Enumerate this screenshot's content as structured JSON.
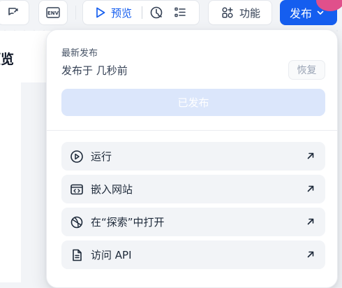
{
  "toolbar": {
    "preview_label": "预览",
    "features_label": "功能",
    "publish_label": "发布",
    "env_icon_text": "ENV"
  },
  "page": {
    "title": "预览"
  },
  "publish_panel": {
    "latest_label": "最新发布",
    "published_time": "发布于 几秒前",
    "restore_label": "恢复",
    "published_button": "已发布",
    "actions": [
      {
        "label": "运行",
        "icon": "play-circle-icon"
      },
      {
        "label": "嵌入网站",
        "icon": "embed-code-icon"
      },
      {
        "label": "在“探索”中打开",
        "icon": "explore-compass-icon"
      },
      {
        "label": "访问 API",
        "icon": "file-text-icon"
      }
    ]
  },
  "colors": {
    "primary": "#155eef",
    "disabled_primary": "#dbe6fb",
    "item_bg": "#f2f4f7"
  }
}
